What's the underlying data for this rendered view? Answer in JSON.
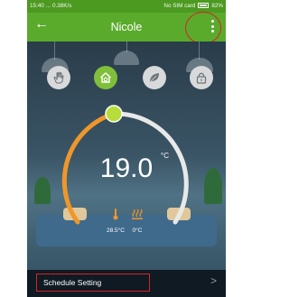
{
  "status_bar": {
    "time": "15:40",
    "dots": "...",
    "speed": "0.38K/s",
    "sim": "No SIM card",
    "battery": "82%"
  },
  "app_bar": {
    "title": "Nicole",
    "back_icon": "back-arrow-icon",
    "menu_icon": "more-vertical-icon"
  },
  "modes": [
    {
      "name": "manual",
      "icon": "hand-icon",
      "active": false
    },
    {
      "name": "program",
      "icon": "home-gear-icon",
      "active": true
    },
    {
      "name": "eco",
      "icon": "leaf-icon",
      "active": false
    },
    {
      "name": "lock",
      "icon": "lock-icon",
      "active": false
    }
  ],
  "thermostat": {
    "setpoint": "19.0",
    "unit": "°C",
    "room_temp": "28.5°C",
    "floor_temp": "0°C"
  },
  "bottom": {
    "schedule_label": "Schedule Setting",
    "chevron": ">"
  },
  "colors": {
    "statusbar": "#4c9a20",
    "appbar": "#5aab2c",
    "arc_orange": "#f0962a",
    "arc_gray": "#e8e8e8",
    "knob": "#b7dd3a",
    "annotation_red": "#d8232a"
  }
}
